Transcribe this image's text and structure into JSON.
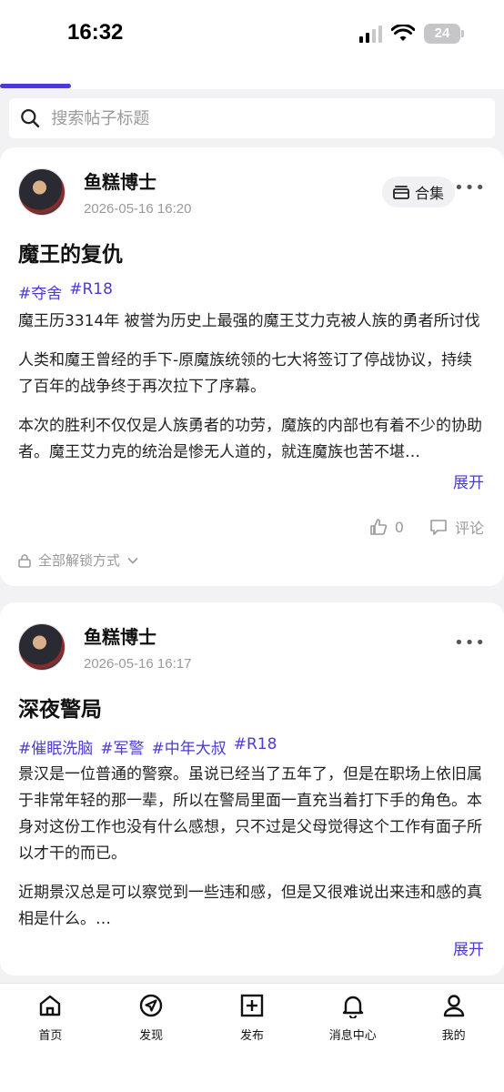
{
  "status": {
    "time": "16:32",
    "battery": "24"
  },
  "search": {
    "placeholder": "搜索帖子标题"
  },
  "posts": [
    {
      "author": "鱼糕博士",
      "time": "2026-05-16 16:20",
      "collection_label": "合集",
      "title": "魔王的复仇",
      "tags": [
        "#夺舍",
        "#R18"
      ],
      "paragraphs": [
        " 魔王历3314年 被誉为历史上最强的魔王艾力克被人族的勇者所讨伐",
        " 人类和魔王曾经的手下-原魔族统领的七大将签订了停战协议，持续了百年的战争终于再次拉下了序幕。",
        " 本次的胜利不仅仅是人族勇者的功劳，魔族的内部也有着不少的协助者。魔王艾力克的统治是惨无人道的，就连魔族也苦不堪…"
      ],
      "expand_label": "展开",
      "likes": "0",
      "comment_label": "评论",
      "unlock_label": "全部解锁方式"
    },
    {
      "author": "鱼糕博士",
      "time": "2026-05-16 16:17",
      "title": "深夜警局",
      "tags": [
        "#催眠洗脑",
        "#军警",
        "#中年大叔",
        "#R18"
      ],
      "paragraphs": [
        " 景汉是一位普通的警察。虽说已经当了五年了，但是在职场上依旧属于非常年轻的那一辈，所以在警局里面一直充当着打下手的角色。本身对这份工作也没有什么感想，只不过是父母觉得这个工作有面子所以才干的而已。",
        " 近期景汉总是可以察觉到一些违和感，但是又很难说出来违和感的真相是什么。…"
      ],
      "expand_label": "展开"
    }
  ],
  "bottom_nav": [
    {
      "label": "首页",
      "icon": "home-icon"
    },
    {
      "label": "发现",
      "icon": "compass-icon"
    },
    {
      "label": "发布",
      "icon": "plus-square-icon"
    },
    {
      "label": "消息中心",
      "icon": "bell-icon"
    },
    {
      "label": "我的",
      "icon": "user-icon"
    }
  ],
  "colors": {
    "accent": "#4b3bd6",
    "background": "#f2f2f4"
  }
}
